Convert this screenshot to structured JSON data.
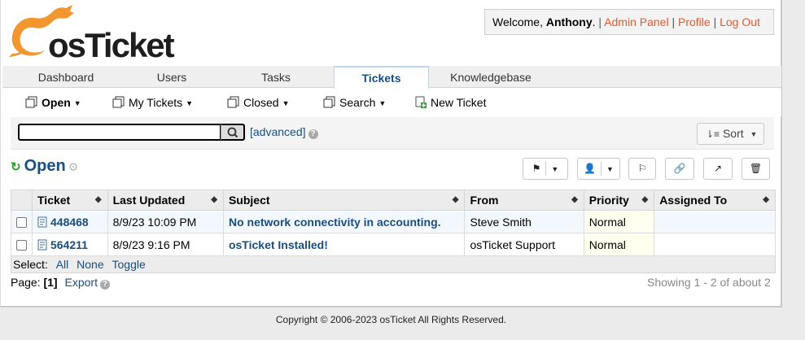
{
  "brand": {
    "logo_text": "osTicket"
  },
  "user": {
    "welcome_prefix": "Welcome,",
    "name": "Anthony",
    "admin_panel": "Admin Panel",
    "profile": "Profile",
    "logout": "Log Out"
  },
  "nav": {
    "tabs": [
      {
        "label": "Dashboard"
      },
      {
        "label": "Users"
      },
      {
        "label": "Tasks"
      },
      {
        "label": "Tickets"
      },
      {
        "label": "Knowledgebase"
      }
    ],
    "active": "Tickets"
  },
  "subnav": {
    "open": "Open",
    "my_tickets": "My Tickets",
    "closed": "Closed",
    "search": "Search",
    "new_ticket": "New Ticket"
  },
  "search": {
    "value": "",
    "advanced": "[advanced]",
    "sort_label": "Sort"
  },
  "queue": {
    "title": "Open"
  },
  "table": {
    "headers": [
      "Ticket",
      "Last Updated",
      "Subject",
      "From",
      "Priority",
      "Assigned To"
    ],
    "rows": [
      {
        "ticket": "448468",
        "updated": "8/9/23 10:09 PM",
        "subject": "No network connectivity in accounting.",
        "from": "Steve Smith",
        "priority": "Normal",
        "assigned": ""
      },
      {
        "ticket": "564211",
        "updated": "8/9/23 9:16 PM",
        "subject": "osTicket Installed!",
        "from": "osTicket Support",
        "priority": "Normal",
        "assigned": ""
      }
    ]
  },
  "select": {
    "label": "Select:",
    "all": "All",
    "none": "None",
    "toggle": "Toggle"
  },
  "paging": {
    "label": "Page:",
    "current": "[1]",
    "export": "Export",
    "showing": "Showing 1 - 2 of about 2"
  },
  "footer": {
    "copyright": "Copyright © 2006-2023 osTicket All Rights Reserved."
  },
  "colors": {
    "accent": "#184e81",
    "link_orange": "#e8582d",
    "logo_orange": "#f2972f",
    "refresh_green": "#2aa02a"
  }
}
